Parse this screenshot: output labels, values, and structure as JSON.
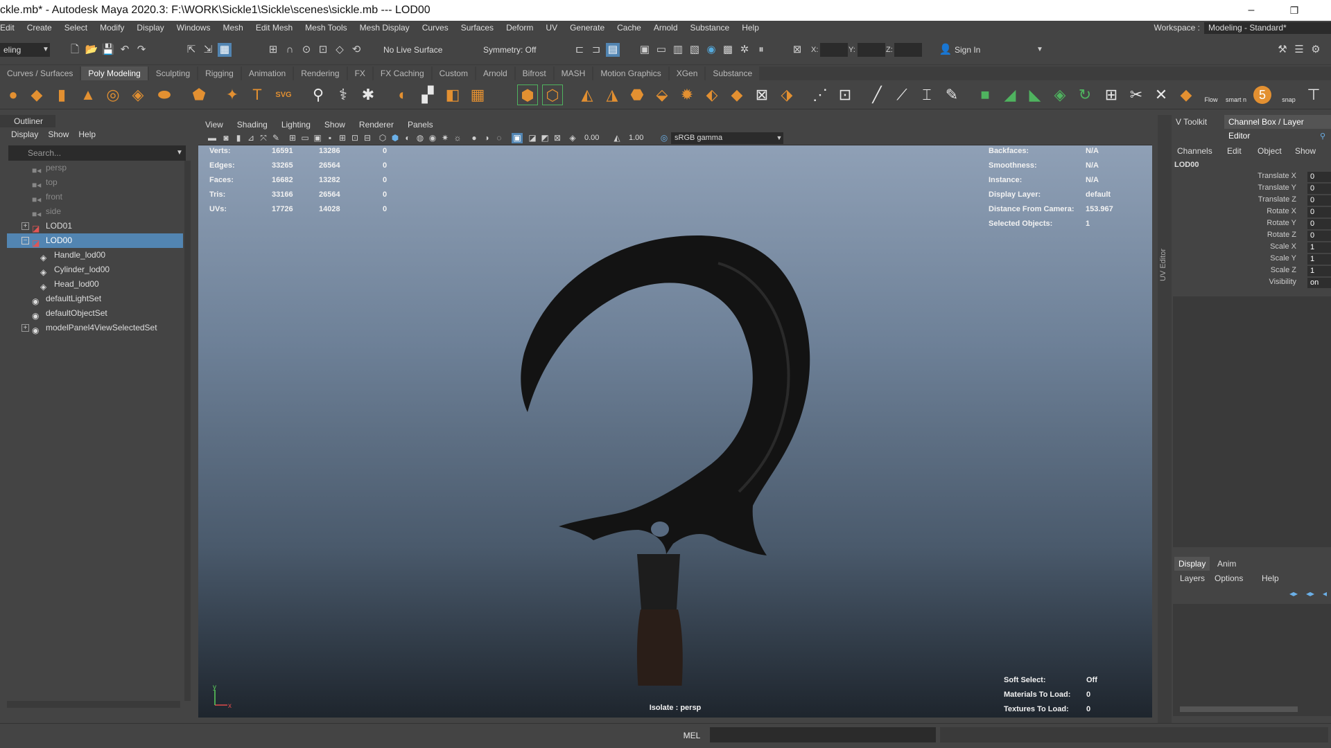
{
  "window": {
    "title": "ckle.mb* - Autodesk Maya 2020.3: F:\\WORK\\Sickle1\\Sickle\\scenes\\sickle.mb    ---    LOD00",
    "minimize": "–",
    "restore": "❐"
  },
  "menubar": {
    "items": [
      "Edit",
      "Create",
      "Select",
      "Modify",
      "Display",
      "Windows",
      "Mesh",
      "Edit Mesh",
      "Mesh Tools",
      "Mesh Display",
      "Curves",
      "Surfaces",
      "Deform",
      "UV",
      "Generate",
      "Cache",
      "Arnold",
      "Substance",
      "Help"
    ],
    "workspace_label": "Workspace :",
    "workspace_value": "Modeling - Standard*"
  },
  "statusline": {
    "mode": "eling",
    "live_surface": "No Live Surface",
    "symmetry": "Symmetry: Off",
    "x_label": "X:",
    "y_label": "Y:",
    "z_label": "Z:",
    "sign_in": "Sign In"
  },
  "shelf": {
    "tabs": [
      "Curves / Surfaces",
      "Poly Modeling",
      "Sculpting",
      "Rigging",
      "Animation",
      "Rendering",
      "FX",
      "FX Caching",
      "Custom",
      "Arnold",
      "Bifrost",
      "MASH",
      "Motion Graphics",
      "XGen",
      "Substance"
    ],
    "active_tab": "Poly Modeling",
    "svg_label": "SVG",
    "flow_label": "Flow",
    "smart_label": "smart n",
    "snap_label": "snap"
  },
  "outliner": {
    "title": "Outliner",
    "menu": [
      "Display",
      "Show",
      "Help"
    ],
    "search_placeholder": "Search...",
    "items": [
      {
        "label": "persp",
        "type": "camera",
        "dim": true
      },
      {
        "label": "top",
        "type": "camera",
        "dim": true
      },
      {
        "label": "front",
        "type": "camera",
        "dim": true
      },
      {
        "label": "side",
        "type": "camera",
        "dim": true
      },
      {
        "label": "LOD01",
        "type": "lod",
        "dim": false
      },
      {
        "label": "LOD00",
        "type": "lod",
        "dim": false,
        "selected": true
      },
      {
        "label": "Handle_lod00",
        "type": "mesh",
        "dim": false
      },
      {
        "label": "Cylinder_lod00",
        "type": "mesh",
        "dim": false
      },
      {
        "label": "Head_lod00",
        "type": "mesh",
        "dim": false
      },
      {
        "label": "defaultLightSet",
        "type": "set",
        "dim": false
      },
      {
        "label": "defaultObjectSet",
        "type": "set",
        "dim": false
      },
      {
        "label": "modelPanel4ViewSelectedSet",
        "type": "set",
        "dim": false
      }
    ]
  },
  "viewport": {
    "menu": [
      "View",
      "Shading",
      "Lighting",
      "Show",
      "Renderer",
      "Panels"
    ],
    "exposure": "0.00",
    "gamma": "1.00",
    "color_space": "sRGB gamma",
    "hud_left": [
      {
        "label": "Verts:",
        "a": "16591",
        "b": "13286",
        "c": "0"
      },
      {
        "label": "Edges:",
        "a": "33265",
        "b": "26564",
        "c": "0"
      },
      {
        "label": "Faces:",
        "a": "16682",
        "b": "13282",
        "c": "0"
      },
      {
        "label": "Tris:",
        "a": "33166",
        "b": "26564",
        "c": "0"
      },
      {
        "label": "UVs:",
        "a": "17726",
        "b": "14028",
        "c": "0"
      }
    ],
    "hud_right": [
      {
        "label": "Backfaces:",
        "value": "N/A"
      },
      {
        "label": "Smoothness:",
        "value": "N/A"
      },
      {
        "label": "Instance:",
        "value": "N/A"
      },
      {
        "label": "Display Layer:",
        "value": "default"
      },
      {
        "label": "Distance From Camera:",
        "value": "153.967"
      },
      {
        "label": "Selected Objects:",
        "value": "1"
      }
    ],
    "hud_bottom": [
      {
        "label": "Soft Select:",
        "value": "Off"
      },
      {
        "label": "Materials To Load:",
        "value": "0"
      },
      {
        "label": "Textures To Load:",
        "value": "0"
      }
    ],
    "isolate": "Isolate : persp",
    "axis_x": "x",
    "axis_y": "y"
  },
  "uv_editor_label": "UV Editor",
  "channelbox": {
    "tabs": [
      "V Toolkit",
      "Channel Box / Layer Editor"
    ],
    "menu": [
      "Channels",
      "Edit",
      "Object",
      "Show"
    ],
    "object": "LOD00",
    "channels": [
      {
        "label": "Translate X",
        "value": "0"
      },
      {
        "label": "Translate Y",
        "value": "0"
      },
      {
        "label": "Translate Z",
        "value": "0"
      },
      {
        "label": "Rotate X",
        "value": "0"
      },
      {
        "label": "Rotate Y",
        "value": "0"
      },
      {
        "label": "Rotate Z",
        "value": "0"
      },
      {
        "label": "Scale X",
        "value": "1"
      },
      {
        "label": "Scale Y",
        "value": "1"
      },
      {
        "label": "Scale Z",
        "value": "1"
      },
      {
        "label": "Visibility",
        "value": "on"
      }
    ],
    "layer_tabs": [
      "Display",
      "Anim"
    ],
    "layer_menu": [
      "Layers",
      "Options",
      "Help"
    ]
  },
  "commandline": {
    "mel": "MEL"
  },
  "colors": {
    "accent_select": "#5285b2",
    "shelf_orange": "#e39031",
    "shelf_green": "#4fb35f"
  }
}
